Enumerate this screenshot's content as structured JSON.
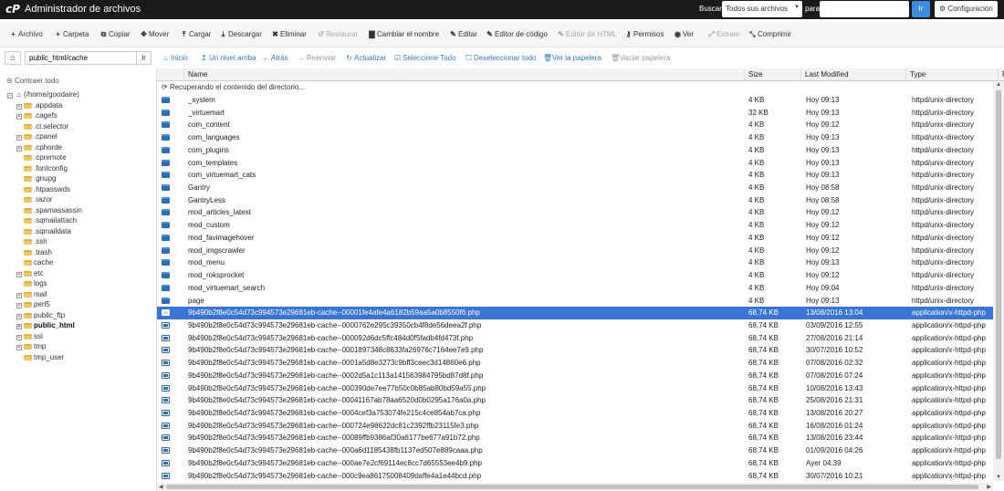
{
  "header": {
    "logo": "cP",
    "title": "Administrador de archivos",
    "search_label": "Buscar",
    "search_scope": "Todos sus archivos",
    "para_label": "para",
    "search_placeholder": "",
    "go_label": "Ir",
    "settings_label": "Configuración",
    "bg_color": "#1a1a1a",
    "accent_color": "#3c8dde"
  },
  "toolbar": {
    "items": [
      {
        "icon": "plus-icon",
        "glyph": "+",
        "label": "Archivo",
        "disabled": false
      },
      {
        "icon": "plus-icon",
        "glyph": "+",
        "label": "Carpeta",
        "disabled": false
      },
      {
        "icon": "copy-icon",
        "glyph": "⧉",
        "label": "Copiar",
        "disabled": false
      },
      {
        "icon": "move-icon",
        "glyph": "✥",
        "label": "Mover",
        "disabled": false
      },
      {
        "icon": "upload-icon",
        "glyph": "⤒",
        "label": "Cargar",
        "disabled": false
      },
      {
        "icon": "download-icon",
        "glyph": "⤓",
        "label": "Descargar",
        "disabled": false
      },
      {
        "icon": "delete-icon",
        "glyph": "✖",
        "label": "Eliminar",
        "disabled": false
      },
      {
        "icon": "restore-icon",
        "glyph": "↺",
        "label": "Restaurar",
        "disabled": true
      },
      {
        "icon": "rename-icon",
        "glyph": "▇",
        "label": "Cambiar el nombre",
        "disabled": false
      },
      {
        "icon": "edit-icon",
        "glyph": "✎",
        "label": "Editar",
        "disabled": false
      },
      {
        "icon": "code-editor-icon",
        "glyph": "✎",
        "label": "Editor de código",
        "disabled": false
      },
      {
        "icon": "html-editor-icon",
        "glyph": "✎",
        "label": "Editor de HTML",
        "disabled": true
      },
      {
        "icon": "permissions-icon",
        "glyph": "⚷",
        "label": "Permisos",
        "disabled": false
      },
      {
        "icon": "view-icon",
        "glyph": "◉",
        "label": "Ver",
        "disabled": false
      },
      {
        "icon": "extract-icon",
        "glyph": "⤢",
        "label": "Extraer",
        "disabled": true
      },
      {
        "icon": "compress-icon",
        "glyph": "⤡",
        "label": "Comprimir",
        "disabled": false
      }
    ]
  },
  "pathbar": {
    "path": "public_html/cache",
    "go_label": "Ir"
  },
  "navbar": {
    "items": [
      {
        "icon": "home-icon",
        "glyph": "⌂",
        "label": "Inicio",
        "disabled": false
      },
      {
        "icon": "up-level-icon",
        "glyph": "↥",
        "label": "Un nivel arriba",
        "disabled": false
      },
      {
        "icon": "back-icon",
        "glyph": "←",
        "label": "Atrás",
        "disabled": false
      },
      {
        "icon": "forward-icon",
        "glyph": "→",
        "label": "Reenviar",
        "disabled": true
      },
      {
        "icon": "reload-icon",
        "glyph": "↻",
        "label": "Actualizar",
        "disabled": false
      },
      {
        "icon": "select-all-icon",
        "glyph": "☑",
        "label": "Seleccione Todo",
        "disabled": false
      },
      {
        "icon": "deselect-all-icon",
        "glyph": "☐",
        "label": "Deseleccionar todo",
        "disabled": false
      },
      {
        "icon": "trash-icon",
        "glyph": "🗑",
        "label": "Ver la papelera",
        "disabled": false
      },
      {
        "icon": "empty-trash-icon",
        "glyph": "🗑",
        "label": "Vaciar papelera",
        "disabled": true
      }
    ]
  },
  "tree": {
    "collapse_label": "Contraer todo",
    "root_label": "(/home/goodaire)",
    "items": [
      {
        "label": ".appdata",
        "plus": true,
        "bold": false
      },
      {
        "label": ".cagefs",
        "plus": true,
        "bold": false
      },
      {
        "label": ".cl.selector",
        "plus": false,
        "bold": false
      },
      {
        "label": ".cpanel",
        "plus": true,
        "bold": false
      },
      {
        "label": ".cphorde",
        "plus": true,
        "bold": false
      },
      {
        "label": ".cpremote",
        "plus": false,
        "bold": false
      },
      {
        "label": ".fontconfig",
        "plus": false,
        "bold": false
      },
      {
        "label": ".gnupg",
        "plus": false,
        "bold": false
      },
      {
        "label": ".htpasswds",
        "plus": false,
        "bold": false
      },
      {
        "label": ".razor",
        "plus": false,
        "bold": false
      },
      {
        "label": ".spamassassin",
        "plus": false,
        "bold": false
      },
      {
        "label": ".sqmailattach",
        "plus": false,
        "bold": false
      },
      {
        "label": ".sqmaildata",
        "plus": false,
        "bold": false
      },
      {
        "label": ".ssh",
        "plus": false,
        "bold": false
      },
      {
        "label": ".trash",
        "plus": false,
        "bold": false
      },
      {
        "label": "cache",
        "plus": false,
        "bold": false
      },
      {
        "label": "etc",
        "plus": true,
        "bold": false
      },
      {
        "label": "logs",
        "plus": false,
        "bold": false
      },
      {
        "label": "mail",
        "plus": true,
        "bold": false
      },
      {
        "label": "perl5",
        "plus": true,
        "bold": false
      },
      {
        "label": "public_ftp",
        "plus": true,
        "bold": false
      },
      {
        "label": "public_html",
        "plus": true,
        "bold": true
      },
      {
        "label": "ssl",
        "plus": true,
        "bold": false
      },
      {
        "label": "tmp",
        "plus": true,
        "bold": false
      },
      {
        "label": "tmp_user",
        "plus": false,
        "bold": false
      }
    ]
  },
  "table": {
    "headers": [
      "Name",
      "Size",
      "Last Modified",
      "Type",
      "P"
    ],
    "loading_text": "Recuperando el contenido del directorio...",
    "selected_color": "#3875d7",
    "rows": [
      {
        "kind": "dir",
        "name": "_system",
        "size": "4 KB",
        "date": "Hoy 09:13",
        "type": "httpd/unix-directory"
      },
      {
        "kind": "dir",
        "name": "_virtuemart",
        "size": "32 KB",
        "date": "Hoy 09:13",
        "type": "httpd/unix-directory"
      },
      {
        "kind": "dir",
        "name": "com_content",
        "size": "4 KB",
        "date": "Hoy 09:12",
        "type": "httpd/unix-directory"
      },
      {
        "kind": "dir",
        "name": "com_languages",
        "size": "4 KB",
        "date": "Hoy 09:13",
        "type": "httpd/unix-directory"
      },
      {
        "kind": "dir",
        "name": "com_plugins",
        "size": "4 KB",
        "date": "Hoy 09:13",
        "type": "httpd/unix-directory"
      },
      {
        "kind": "dir",
        "name": "com_templates",
        "size": "4 KB",
        "date": "Hoy 09:13",
        "type": "httpd/unix-directory"
      },
      {
        "kind": "dir",
        "name": "com_virtuemart_cats",
        "size": "4 KB",
        "date": "Hoy 09:13",
        "type": "httpd/unix-directory"
      },
      {
        "kind": "dir",
        "name": "Gantry",
        "size": "4 KB",
        "date": "Hoy 08:58",
        "type": "httpd/unix-directory"
      },
      {
        "kind": "dir",
        "name": "GantryLess",
        "size": "4 KB",
        "date": "Hoy 08:58",
        "type": "httpd/unix-directory"
      },
      {
        "kind": "dir",
        "name": "mod_articles_latest",
        "size": "4 KB",
        "date": "Hoy 09:12",
        "type": "httpd/unix-directory"
      },
      {
        "kind": "dir",
        "name": "mod_custom",
        "size": "4 KB",
        "date": "Hoy 09:12",
        "type": "httpd/unix-directory"
      },
      {
        "kind": "dir",
        "name": "mod_favimagehover",
        "size": "4 KB",
        "date": "Hoy 09:12",
        "type": "httpd/unix-directory"
      },
      {
        "kind": "dir",
        "name": "mod_imgscrawler",
        "size": "4 KB",
        "date": "Hoy 09:12",
        "type": "httpd/unix-directory"
      },
      {
        "kind": "dir",
        "name": "mod_menu",
        "size": "4 KB",
        "date": "Hoy 09:13",
        "type": "httpd/unix-directory"
      },
      {
        "kind": "dir",
        "name": "mod_roksprocket",
        "size": "4 KB",
        "date": "Hoy 09:12",
        "type": "httpd/unix-directory"
      },
      {
        "kind": "dir",
        "name": "mod_virtuemart_search",
        "size": "4 KB",
        "date": "Hoy 09:04",
        "type": "httpd/unix-directory"
      },
      {
        "kind": "dir",
        "name": "page",
        "size": "4 KB",
        "date": "Hoy 09:13",
        "type": "httpd/unix-directory"
      },
      {
        "kind": "php",
        "selected": true,
        "name": "9b490b2f8e0c54d73c994573e29681eb-cache--00001fe4afe4a6182b59aa5a0b8550f6.php",
        "size": "68,74 KB",
        "date": "13/08/2016 13:04",
        "type": "application/x-httpd-php"
      },
      {
        "kind": "php",
        "name": "9b490b2f8e0c54d73c994573e29681eb-cache--0000762e295c39350cb4f8de56deea2f.php",
        "size": "68,74 KB",
        "date": "03/09/2016 12:55",
        "type": "application/x-httpd-php"
      },
      {
        "kind": "php",
        "name": "9b490b2f8e0c54d73c994573e29681eb-cache--000092d6dc5ffc484d0f5fadb4fd473f.php",
        "size": "68,74 KB",
        "date": "27/08/2016 21:14",
        "type": "application/x-httpd-php"
      },
      {
        "kind": "php",
        "name": "9b490b2f8e0c54d73c994573e29681eb-cache--0001897348c8633fa26976c7164ee7e9.php",
        "size": "68,74 KB",
        "date": "30/07/2016 10:52",
        "type": "application/x-httpd-php"
      },
      {
        "kind": "php",
        "name": "9b490b2f8e0c54d73c994573e29681eb-cache--0001a5d8e3273c9bff3ceec3d14860e6.php",
        "size": "68,74 KB",
        "date": "07/08/2016 02:32",
        "type": "application/x-httpd-php"
      },
      {
        "kind": "php",
        "name": "9b490b2f8e0c54d73c994573e29681eb-cache--0002d5a1c113a141563984795bd87d8f.php",
        "size": "68,74 KB",
        "date": "07/08/2016 07:24",
        "type": "application/x-httpd-php"
      },
      {
        "kind": "php",
        "name": "9b490b2f8e0c54d73c994573e29681eb-cache--000390de7ee77b50c0b85ab80bd59a55.php",
        "size": "68,74 KB",
        "date": "10/08/2016 13:43",
        "type": "application/x-httpd-php"
      },
      {
        "kind": "php",
        "name": "9b490b2f8e0c54d73c994573e29681eb-cache--00041167ab78aa6520d0b0295a176a0a.php",
        "size": "68,74 KB",
        "date": "25/08/2016 21:31",
        "type": "application/x-httpd-php"
      },
      {
        "kind": "php",
        "name": "9b490b2f8e0c54d73c994573e29681eb-cache--0004cef3a753074fe215c4ce854ab7ca.php",
        "size": "68,74 KB",
        "date": "13/08/2016 20:27",
        "type": "application/x-httpd-php"
      },
      {
        "kind": "php",
        "name": "9b490b2f8e0c54d73c994573e29681eb-cache--000724e98622dc81c2392ffb23115fe3.php",
        "size": "68,74 KB",
        "date": "16/08/2016 01:24",
        "type": "application/x-httpd-php"
      },
      {
        "kind": "php",
        "name": "9b490b2f8e0c54d73c994573e29681eb-cache--00089ffb9386af30a6177be677a91b72.php",
        "size": "68,74 KB",
        "date": "13/08/2016 23:44",
        "type": "application/x-httpd-php"
      },
      {
        "kind": "php",
        "name": "9b490b2f8e0c54d73c994573e29681eb-cache--000a6d1185438fb1137ed507e889caaa.php",
        "size": "68,74 KB",
        "date": "01/09/2016 04:26",
        "type": "application/x-httpd-php"
      },
      {
        "kind": "php",
        "name": "9b490b2f8e0c54d73c994573e29681eb-cache--000ae7e2cf69114ec8cc7d65553ee4b9.php",
        "size": "68,74 KB",
        "date": "Ayer 04:39",
        "type": "application/x-httpd-php"
      },
      {
        "kind": "php",
        "name": "9b490b2f8e0c54d73c994573e29681eb-cache--000c9ea86175008409daffe4a1e44bcd.php",
        "size": "68,74 KB",
        "date": "30/07/2016 10:21",
        "type": "application/x-httpd-php"
      }
    ]
  }
}
